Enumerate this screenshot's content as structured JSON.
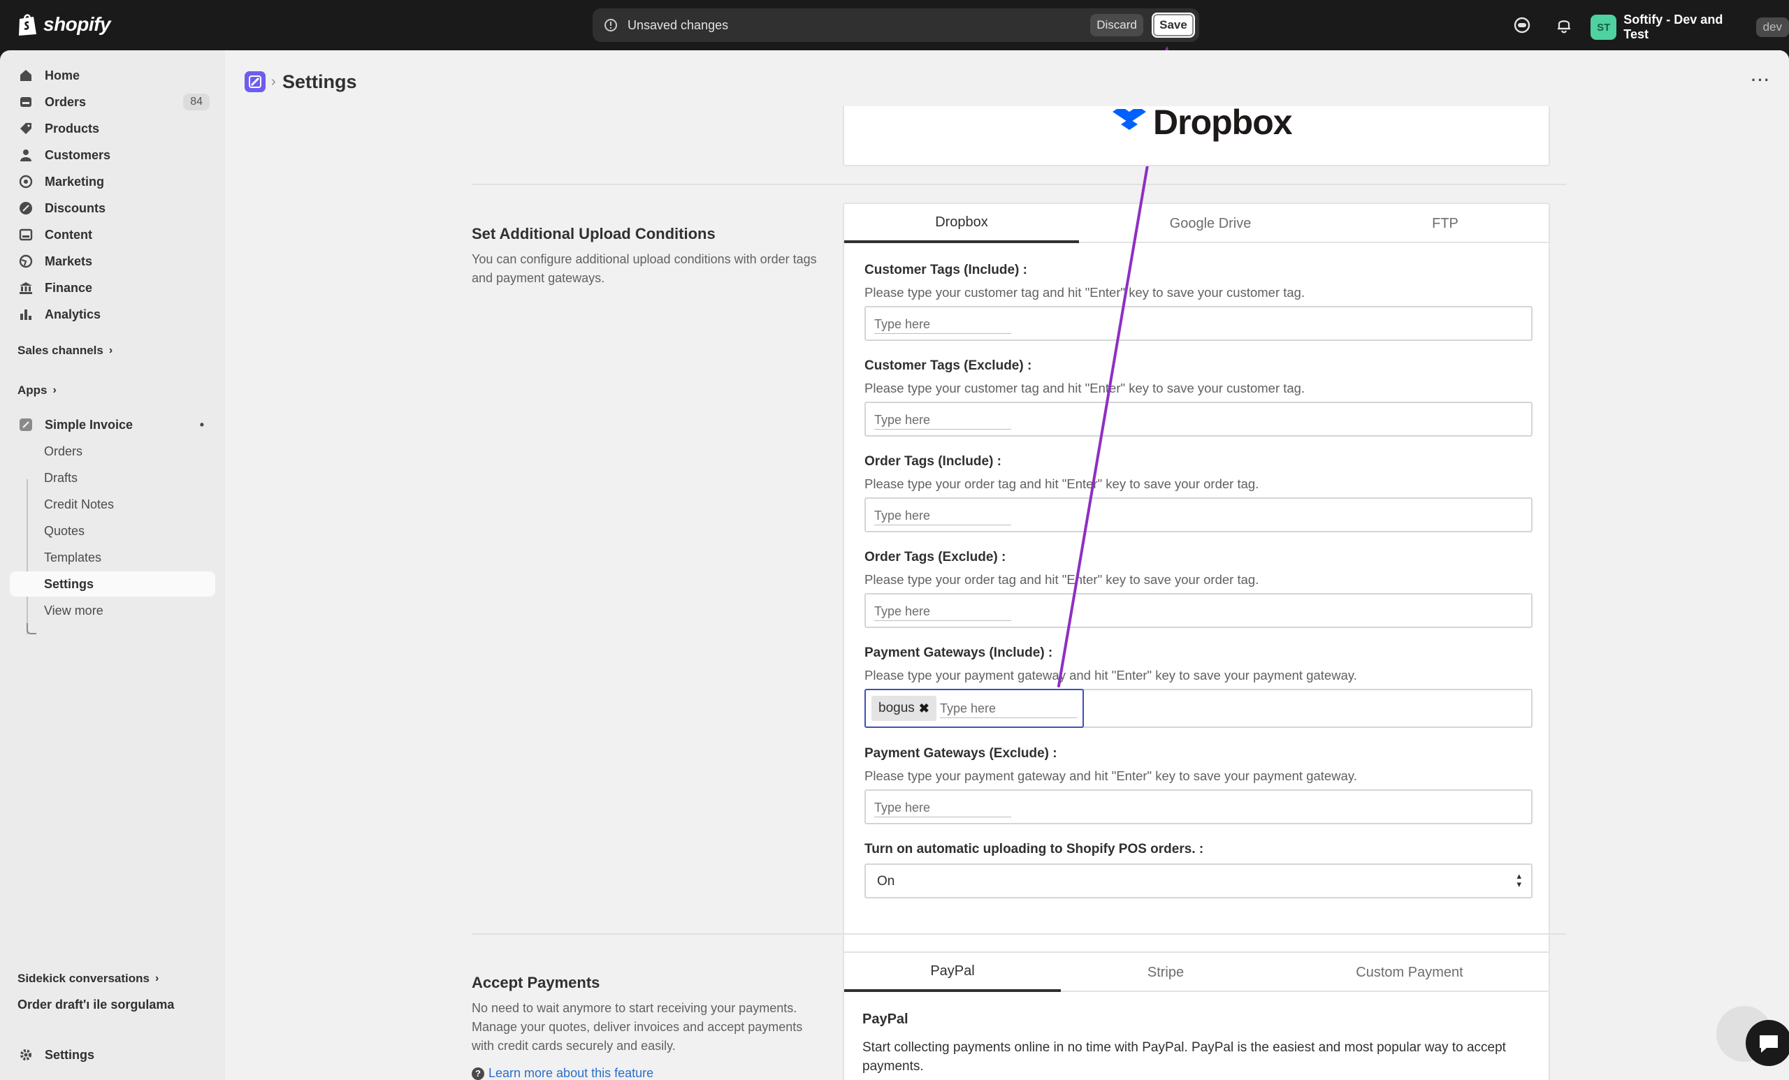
{
  "topbar": {
    "logo_text": "shopify",
    "unsaved_message": "Unsaved changes",
    "discard_label": "Discard",
    "save_label": "Save",
    "store_initials": "ST",
    "store_name": "Softify - Dev and Test",
    "store_badge": "dev"
  },
  "sidebar": {
    "items": [
      {
        "label": "Home",
        "icon": "home-icon"
      },
      {
        "label": "Orders",
        "icon": "orders-icon",
        "count": "84"
      },
      {
        "label": "Products",
        "icon": "tag-icon"
      },
      {
        "label": "Customers",
        "icon": "person-icon"
      },
      {
        "label": "Marketing",
        "icon": "target-icon"
      },
      {
        "label": "Discounts",
        "icon": "discount-icon"
      },
      {
        "label": "Content",
        "icon": "content-icon"
      },
      {
        "label": "Markets",
        "icon": "globe-icon"
      },
      {
        "label": "Finance",
        "icon": "bank-icon"
      },
      {
        "label": "Analytics",
        "icon": "bar-chart-icon"
      }
    ],
    "sales_channels": "Sales channels",
    "apps": "Apps",
    "app_name": "Simple Invoice",
    "app_sub_items": [
      "Orders",
      "Drafts",
      "Credit Notes",
      "Quotes",
      "Templates",
      "Settings",
      "View more"
    ],
    "sidekick": "Sidekick conversations",
    "sidekick_item": "Order draft'ı ile sorgulama",
    "settings": "Settings"
  },
  "page": {
    "title": "Settings"
  },
  "logo_card": {
    "brand": "Dropbox"
  },
  "upload_conditions": {
    "title": "Set Additional Upload Conditions",
    "description": "You can configure additional upload conditions with order tags and payment gateways.",
    "tabs": [
      "Dropbox",
      "Google Drive",
      "FTP"
    ],
    "active_tab": "Dropbox",
    "placeholder": "Type here",
    "fields": [
      {
        "label": "Customer Tags (Include) :",
        "help": "Please type your customer tag and hit \"Enter\" key to save your customer tag."
      },
      {
        "label": "Customer Tags (Exclude) :",
        "help": "Please type your customer tag and hit \"Enter\" key to save your customer tag."
      },
      {
        "label": "Order Tags (Include) :",
        "help": "Please type your order tag and hit \"Enter\" key to save your order tag."
      },
      {
        "label": "Order Tags (Exclude) :",
        "help": "Please type your order tag and hit \"Enter\" key to save your order tag."
      },
      {
        "label": "Payment Gateways (Include) :",
        "help": "Please type your payment gateway and hit \"Enter\" key to save your payment gateway.",
        "tags": [
          "bogus"
        ]
      },
      {
        "label": "Payment Gateways (Exclude) :",
        "help": "Please type your payment gateway and hit \"Enter\" key to save your payment gateway."
      }
    ],
    "pos_label": "Turn on automatic uploading to Shopify POS orders. :",
    "pos_value": "On"
  },
  "accept_payments": {
    "title": "Accept Payments",
    "description": "No need to wait anymore to start receiving your payments. Manage your quotes, deliver invoices and accept payments with credit cards securely and easily.",
    "learn_more": "Learn more about this feature",
    "tabs": [
      "PayPal",
      "Stripe",
      "Custom Payment"
    ],
    "active_tab": "PayPal",
    "panel_title": "PayPal",
    "panel_text": "Start collecting payments online in no time with PayPal. PayPal is the easiest and most popular way to accept payments."
  },
  "colors": {
    "annotation_arrow": "#8e2fc4",
    "focus_border": "#3f51b5",
    "app_icon": "#6d5cf0"
  }
}
